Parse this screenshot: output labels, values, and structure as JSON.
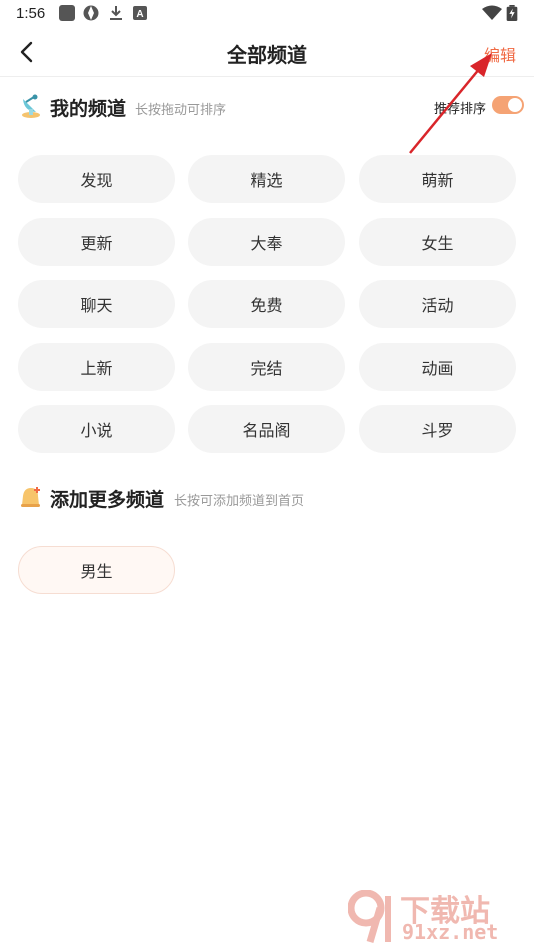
{
  "status_bar": {
    "time": "1:56",
    "left_icons": [
      "app-square-icon",
      "aperture-icon",
      "download-icon",
      "font-a-icon"
    ],
    "right_icons": [
      "wifi-icon",
      "battery-icon"
    ]
  },
  "header": {
    "title": "全部频道",
    "edit_label": "编辑",
    "back_icon": "back-chevron-icon"
  },
  "my_channels": {
    "title": "我的频道",
    "hint": "长按拖动可排序",
    "toggle_label": "推荐排序",
    "toggle_on": true,
    "items": [
      "发现",
      "精选",
      "萌新",
      "更新",
      "大奉",
      "女生",
      "聊天",
      "免费",
      "活动",
      "上新",
      "完结",
      "动画",
      "小说",
      "名品阁",
      "斗罗"
    ]
  },
  "more_channels": {
    "title": "添加更多频道",
    "hint": "长按可添加频道到首页",
    "items": [
      "男生"
    ]
  },
  "watermark": {
    "line1": "下载站",
    "line2": "91xz.net"
  },
  "colors": {
    "accent": "#f06a44",
    "toggle": "#f5a374",
    "chip_bg": "#f4f4f4",
    "arrow": "#d9252a"
  }
}
